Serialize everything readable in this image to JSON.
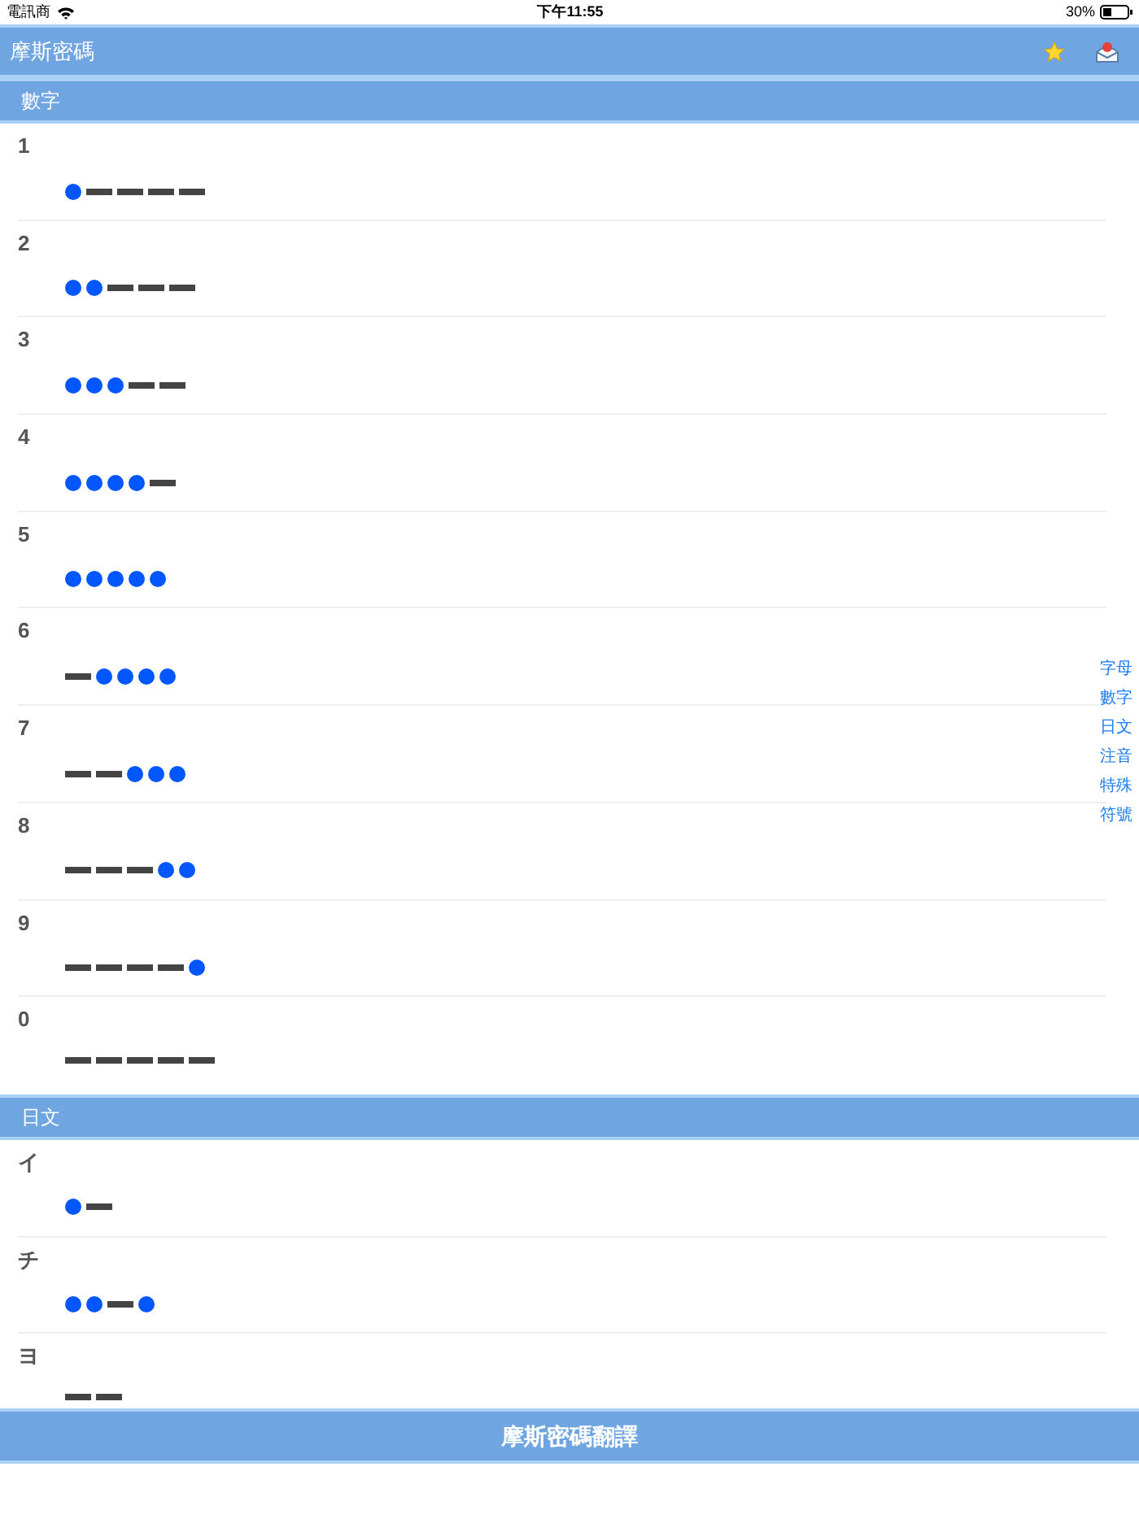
{
  "status_bar": {
    "carrier": "電訊商",
    "time": "下午11:55",
    "battery": "30%"
  },
  "header": {
    "title": "摩斯密碼"
  },
  "sections": [
    {
      "title": "數字",
      "rows": [
        {
          "label": "1",
          "signals": [
            {
              "kind": "dot"
            },
            {
              "kind": "dash"
            },
            {
              "kind": "dash"
            },
            {
              "kind": "dash"
            },
            {
              "kind": "dash"
            }
          ]
        },
        {
          "label": "2",
          "signals": [
            {
              "kind": "dot"
            },
            {
              "kind": "dot"
            },
            {
              "kind": "dash"
            },
            {
              "kind": "dash"
            },
            {
              "kind": "dash"
            }
          ]
        },
        {
          "label": "3",
          "signals": [
            {
              "kind": "dot"
            },
            {
              "kind": "dot"
            },
            {
              "kind": "dot"
            },
            {
              "kind": "dash"
            },
            {
              "kind": "dash"
            }
          ]
        },
        {
          "label": "4",
          "signals": [
            {
              "kind": "dot"
            },
            {
              "kind": "dot"
            },
            {
              "kind": "dot"
            },
            {
              "kind": "dot"
            },
            {
              "kind": "dash"
            }
          ]
        },
        {
          "label": "5",
          "signals": [
            {
              "kind": "dot"
            },
            {
              "kind": "dot"
            },
            {
              "kind": "dot"
            },
            {
              "kind": "dot"
            },
            {
              "kind": "dot"
            }
          ]
        },
        {
          "label": "6",
          "signals": [
            {
              "kind": "dash"
            },
            {
              "kind": "dot"
            },
            {
              "kind": "dot"
            },
            {
              "kind": "dot"
            },
            {
              "kind": "dot"
            }
          ]
        },
        {
          "label": "7",
          "signals": [
            {
              "kind": "dash"
            },
            {
              "kind": "dash"
            },
            {
              "kind": "dot"
            },
            {
              "kind": "dot"
            },
            {
              "kind": "dot"
            }
          ]
        },
        {
          "label": "8",
          "signals": [
            {
              "kind": "dash"
            },
            {
              "kind": "dash"
            },
            {
              "kind": "dash"
            },
            {
              "kind": "dot"
            },
            {
              "kind": "dot"
            }
          ]
        },
        {
          "label": "9",
          "signals": [
            {
              "kind": "dash"
            },
            {
              "kind": "dash"
            },
            {
              "kind": "dash"
            },
            {
              "kind": "dash"
            },
            {
              "kind": "dot"
            }
          ]
        },
        {
          "label": "0",
          "signals": [
            {
              "kind": "dash"
            },
            {
              "kind": "dash"
            },
            {
              "kind": "dash"
            },
            {
              "kind": "dash"
            },
            {
              "kind": "dash"
            }
          ]
        }
      ]
    },
    {
      "title": "日文",
      "rows": [
        {
          "label": "イ",
          "signals": [
            {
              "kind": "dot"
            },
            {
              "kind": "dash"
            }
          ]
        },
        {
          "label": "チ",
          "signals": [
            {
              "kind": "dot"
            },
            {
              "kind": "dot"
            },
            {
              "kind": "dash"
            },
            {
              "kind": "dot"
            }
          ]
        },
        {
          "label": "ヨ",
          "signals": [
            {
              "kind": "dash"
            },
            {
              "kind": "dash"
            }
          ]
        }
      ]
    }
  ],
  "index": [
    "字母",
    "數字",
    "日文",
    "注音",
    "特殊",
    "符號"
  ],
  "bottom_button": "摩斯密碼翻譯"
}
